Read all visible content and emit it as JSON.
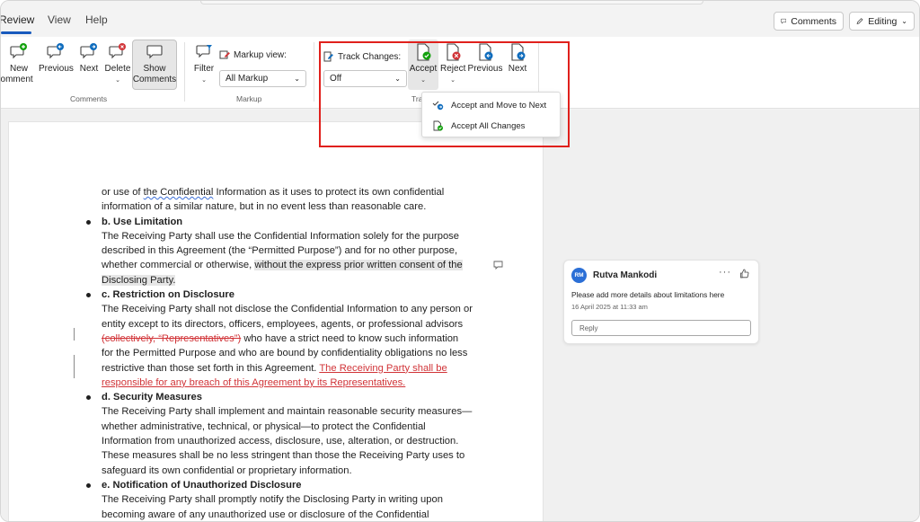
{
  "tabs": {
    "review": "Review",
    "view": "View",
    "help": "Help"
  },
  "topbar": {
    "comments_label": "Comments",
    "editing_label": "Editing"
  },
  "ribbon": {
    "comments_group": {
      "label": "Comments",
      "new_comment": [
        "New",
        "Comment"
      ],
      "previous": "Previous",
      "next": "Next",
      "delete": "Delete",
      "show_comments": [
        "Show",
        "Comments"
      ]
    },
    "markup_group": {
      "label": "Markup",
      "filter": "Filter",
      "markup_view_label": "Markup view:",
      "markup_view_value": "All Markup"
    },
    "tracking_group": {
      "label": "Tra",
      "track_changes_label": "Track Changes:",
      "track_changes_value": "Off",
      "accept": "Accept",
      "reject": "Reject",
      "previous": "Previous",
      "next": "Next"
    }
  },
  "accept_menu": {
    "items": [
      "Accept and Move to Next",
      "Accept All Changes"
    ]
  },
  "document": {
    "line1a": "or use of ",
    "line1_link": "the Confidential",
    "line1b": " Information as it uses to protect its own confidential",
    "line2": "information of a similar nature, but in no event less than reasonable care.",
    "b_heading": "b. Use Limitation",
    "b_body_1": " The Receiving Party shall use the Confidential Information solely for the purpose",
    "b_body_2": "described in this Agreement (the “Permitted Purpose”) and for no other purpose,",
    "b_body_3": "whether commercial or otherwise, ",
    "b_body_hl": "without the express prior written consent of the",
    "b_body_hl2": "Disclosing Party.",
    "c_heading": "c. Restriction on Disclosure",
    "c_body_1": " The Receiving Party shall not disclose the Confidential Information to any person or",
    "c_body_2": "entity except to its directors, officers, employees, agents, or professional advisors",
    "c_body_del": "(collectively, “Representatives”)",
    "c_body_3": " who have a strict need to know such information",
    "c_body_4": "for the Permitted Purpose and who are bound by confidentiality obligations no less",
    "c_body_5": "restrictive than those set forth in this Agreement. ",
    "c_body_ins1": "The Receiving Party shall be",
    "c_body_ins2": "responsible for any breach of this Agreement by its Representatives.",
    "d_heading": "d. Security Measures",
    "d_body_1": " The Receiving Party shall implement and maintain reasonable security measures—",
    "d_body_2": "whether administrative, technical, or physical—to protect the Confidential",
    "d_body_3": "Information from unauthorized access, disclosure, use, alteration, or destruction.",
    "d_body_4": "These measures shall be no less stringent than those the Receiving Party uses to",
    "d_body_5": "safeguard its own confidential or proprietary information.",
    "e_heading": "e. Notification of Unauthorized Disclosure",
    "e_body_1": " The Receiving Party shall promptly notify the Disclosing Party in writing upon",
    "e_body_2": "becoming aware of any unauthorized use or disclosure of the Confidential"
  },
  "comment": {
    "initials": "RM",
    "author": "Rutva Mankodi",
    "more": "···",
    "text": "Please add more details about limitations here",
    "date": "16 April 2025 at 11:33 am",
    "reply_placeholder": "Reply"
  },
  "colors": {
    "accent": "#185abd",
    "track_red": "#d13438",
    "highlight_box": "#e0201c",
    "avatar": "#2b6fd6"
  }
}
